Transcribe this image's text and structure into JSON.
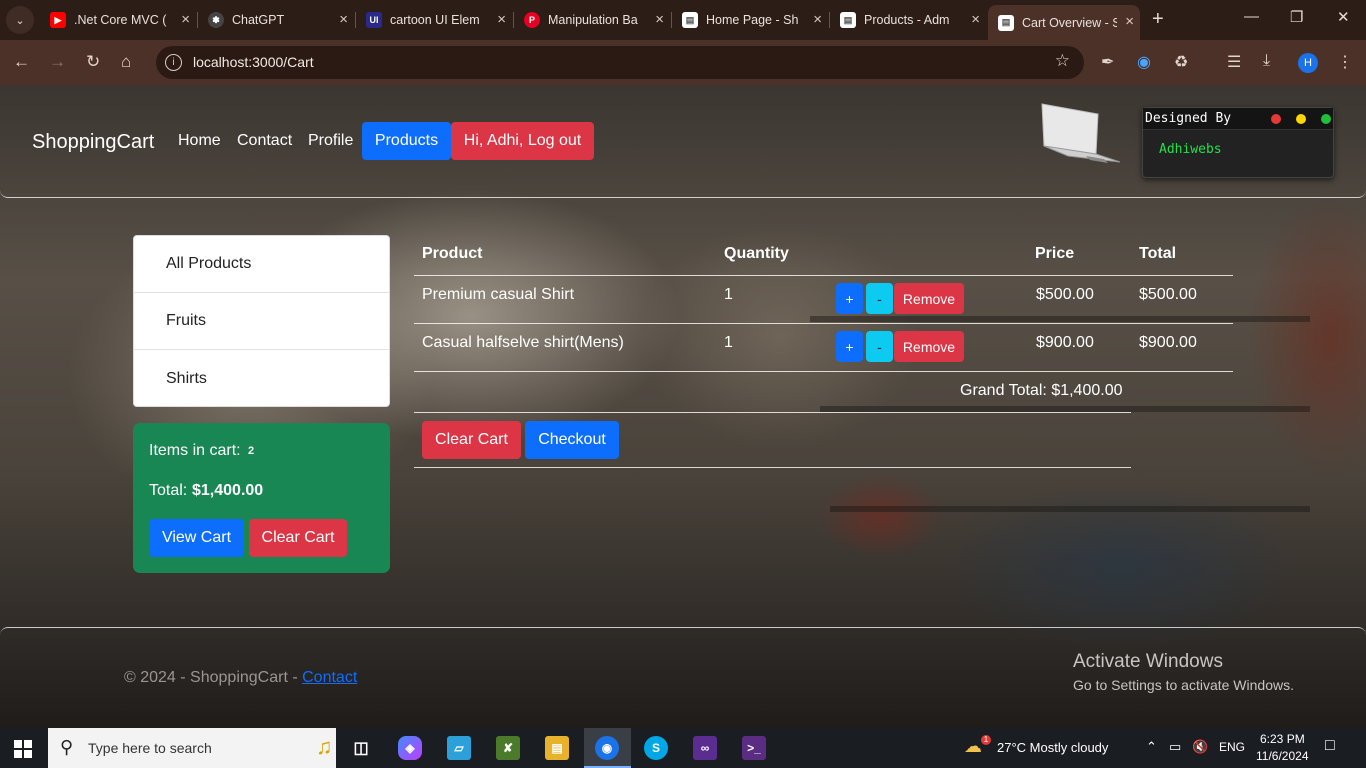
{
  "browser": {
    "tabs": [
      {
        "title": ".Net Core MVC (",
        "favicon": "youtube-icon",
        "color": "#ff0000"
      },
      {
        "title": "ChatGPT",
        "favicon": "chatgpt-icon",
        "color": "#444444"
      },
      {
        "title": "cartoon UI Elem",
        "favicon": "ui-icon",
        "color": "#2a2a8a"
      },
      {
        "title": "Manipulation Ba",
        "favicon": "pinterest-icon",
        "color": "#e60023"
      },
      {
        "title": "Home Page - Sh",
        "favicon": "page-icon",
        "color": "#ffffff"
      },
      {
        "title": "Products - Adm",
        "favicon": "page-icon",
        "color": "#ffffff"
      },
      {
        "title": "Cart Overview - S",
        "favicon": "page-icon",
        "color": "#ffffff",
        "active": true
      }
    ],
    "url": "localhost:3000/Cart",
    "profile_initial": "H"
  },
  "header": {
    "brand": "ShoppingCart",
    "nav": [
      "Home",
      "Contact",
      "Profile"
    ],
    "products_button": "Products",
    "logout_button": "Hi, Adhi, Log out",
    "designer": {
      "title": "Designed By",
      "name": "Adhiwebs"
    }
  },
  "sidebar": {
    "categories": [
      "All Products",
      "Fruits",
      "Shirts"
    ],
    "summary": {
      "items_label": "Items in cart:",
      "items_count": "2",
      "total_label": "Total:",
      "total_value": "$1,400.00",
      "view_cart": "View Cart",
      "clear_cart": "Clear Cart"
    }
  },
  "cart": {
    "headers": {
      "product": "Product",
      "quantity": "Quantity",
      "price": "Price",
      "total": "Total"
    },
    "rows": [
      {
        "product": "Premium casual Shirt",
        "quantity": "1",
        "price": "$500.00",
        "total": "$500.00"
      },
      {
        "product": "Casual halfselve shirt(Mens)",
        "quantity": "1",
        "price": "$900.00",
        "total": "$900.00"
      }
    ],
    "plus_label": "+",
    "minus_label": "-",
    "remove_label": "Remove",
    "grand_total": "Grand Total: $1,400.00",
    "clear_cart": "Clear Cart",
    "checkout": "Checkout"
  },
  "footer": {
    "copyright": "© 2024 - ShoppingCart -",
    "contact_link": "Contact"
  },
  "watermark": {
    "title": "Activate Windows",
    "subtitle": "Go to Settings to activate Windows."
  },
  "taskbar": {
    "search_placeholder": "Type here to search",
    "weather": "27°C  Mostly cloudy",
    "language": "ENG",
    "time": "6:23 PM",
    "date": "11/6/2024",
    "weather_badge": "1"
  },
  "colors": {
    "primary": "#0d6efd",
    "danger": "#dc3545",
    "success": "#198754",
    "info": "#0dcaf0"
  }
}
